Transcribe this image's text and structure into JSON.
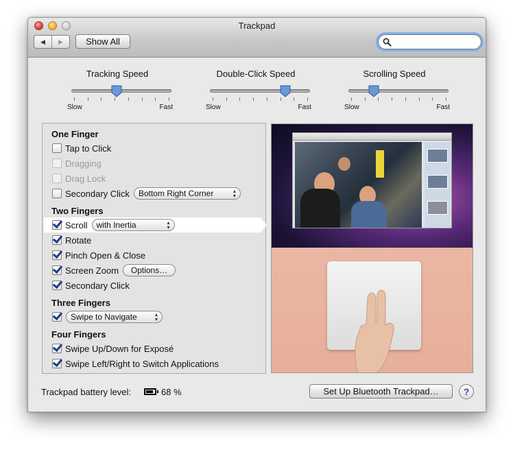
{
  "window": {
    "title": "Trackpad"
  },
  "toolbar": {
    "back_label": "◀",
    "forward_label": "▶",
    "show_all_label": "Show All",
    "search_placeholder": ""
  },
  "sliders": [
    {
      "title": "Tracking Speed",
      "min_label": "Slow",
      "max_label": "Fast",
      "value": 0.45
    },
    {
      "title": "Double-Click Speed",
      "min_label": "Slow",
      "max_label": "Fast",
      "value": 0.75
    },
    {
      "title": "Scrolling Speed",
      "min_label": "Slow",
      "max_label": "Fast",
      "value": 0.25
    }
  ],
  "one_finger": {
    "heading": "One Finger",
    "tap_to_click": {
      "label": "Tap to Click",
      "checked": false
    },
    "dragging": {
      "label": "Dragging",
      "checked": false,
      "enabled": false
    },
    "drag_lock": {
      "label": "Drag Lock",
      "checked": false,
      "enabled": false
    },
    "secondary_click": {
      "label": "Secondary Click",
      "checked": false,
      "option": "Bottom Right Corner"
    }
  },
  "two_fingers": {
    "heading": "Two Fingers",
    "scroll": {
      "label": "Scroll",
      "checked": true,
      "option": "with Inertia"
    },
    "rotate": {
      "label": "Rotate",
      "checked": true
    },
    "pinch": {
      "label": "Pinch Open & Close",
      "checked": true
    },
    "screen_zoom": {
      "label": "Screen Zoom",
      "checked": true,
      "options_button": "Options…"
    },
    "secondary_click": {
      "label": "Secondary Click",
      "checked": true
    }
  },
  "three_fingers": {
    "heading": "Three Fingers",
    "navigate": {
      "checked": true,
      "option": "Swipe to Navigate"
    }
  },
  "four_fingers": {
    "heading": "Four Fingers",
    "expose": {
      "label": "Swipe Up/Down for Exposé",
      "checked": true
    },
    "switch_apps": {
      "label": "Swipe Left/Right to Switch Applications",
      "checked": true
    }
  },
  "footer": {
    "battery_label": "Trackpad battery level:",
    "battery_value": "68 %",
    "battery_level": 0.68,
    "setup_button": "Set Up Bluetooth Trackpad…",
    "help_label": "?"
  },
  "icons": {
    "search": "search-icon",
    "battery": "battery-icon",
    "help": "help-icon",
    "back": "back-arrow-icon",
    "forward": "forward-arrow-icon"
  },
  "colors": {
    "focus_ring": "#7fb0ea",
    "checkmark": "#1a3f86",
    "window_bg": "#e9e9e9"
  }
}
